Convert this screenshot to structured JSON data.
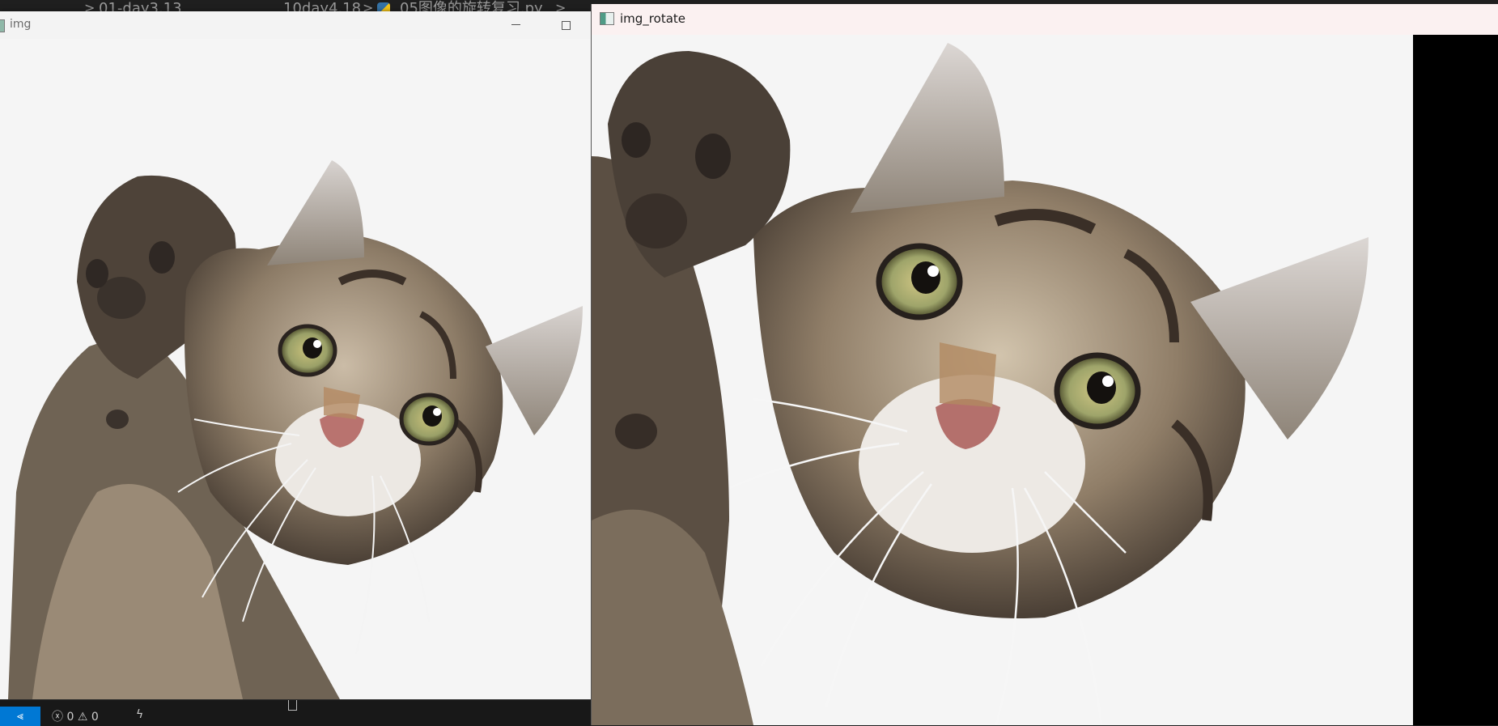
{
  "editor": {
    "breadcrumb_folder": "01-day3.13",
    "breadcrumb_subfolder": "10day4.18",
    "breadcrumb_file": "05图像的旋转复习.py",
    "chevron": ">"
  },
  "window_original": {
    "title": "img",
    "minimize_icon": "minimize-icon",
    "maximize_icon": "maximize-icon"
  },
  "window_rotated": {
    "title": "img_rotate",
    "app_icon": "opencv-window-icon"
  },
  "statusbar": {
    "remote_icon": "remote-icon",
    "remote_glyph": "⪡",
    "errors_glyph": "ⓧ",
    "errors": "0",
    "warnings_glyph": "⚠",
    "warnings": "0",
    "bolt_glyph": "ϟ"
  },
  "colors": {
    "remote_accent": "#0078d4",
    "rotate_titlebar": "#fbf1f1",
    "image_bg": "#f5f5f5"
  }
}
